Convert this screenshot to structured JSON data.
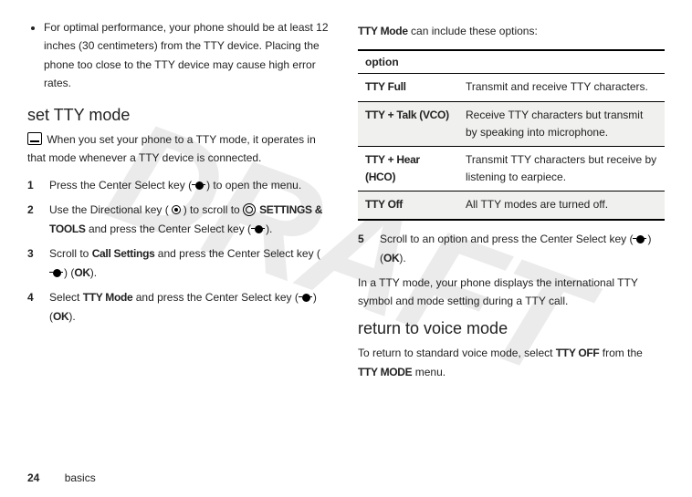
{
  "watermark": "DRAFT",
  "left": {
    "bullet": "For optimal performance, your phone should be at least 12 inches (30 centimeters) from the TTY device. Placing the phone too close to the TTY device may cause high error rates.",
    "heading": "set TTY mode",
    "intro": "When you set your phone to a TTY mode, it operates in that mode whenever a TTY device is connected.",
    "steps": {
      "s1": "Press the Center Select key (",
      "s1b": ") to open the menu.",
      "s2": "Use the Directional key (",
      "s2b": ") to scroll to ",
      "s2menu": "SETTINGS & TOOLS",
      "s2c": " and press the Center Select key (",
      "s2d": ").",
      "s3a": "Scroll to ",
      "s3item": "Call Settings",
      "s3b": " and press the Center Select key (",
      "s3ok": "OK",
      "s3c": ").",
      "s4a": "Select ",
      "s4item": "TTY Mode",
      "s4b": " and press the Center Select key (",
      "s4ok": "OK",
      "s4c": ")."
    }
  },
  "right": {
    "lead_a": "TTY Mode",
    "lead_b": " can include these options:",
    "table": {
      "header": "option",
      "rows": [
        {
          "name": "TTY Full",
          "desc": "Transmit and receive TTY characters."
        },
        {
          "name": "TTY + Talk  (VCO)",
          "desc": "Receive TTY characters but transmit by speaking into microphone."
        },
        {
          "name": "TTY + Hear (HCO)",
          "desc": "Transmit TTY characters but receive by listening to earpiece."
        },
        {
          "name": "TTY Off",
          "desc": "All TTY modes are turned off."
        }
      ]
    },
    "step5a": "Scroll to an option and press the Center Select key (",
    "step5ok": "OK",
    "step5b": ").",
    "para1": "In a TTY mode, your phone displays the international TTY symbol and mode setting during a TTY call.",
    "heading2": "return to voice mode",
    "para2a": "To return to standard voice mode, select ",
    "para2item": "TTY OFF",
    "para2b": " from the ",
    "para2menu": "TTY MODE",
    "para2c": " menu."
  },
  "footer": {
    "page": "24",
    "section": "basics"
  }
}
